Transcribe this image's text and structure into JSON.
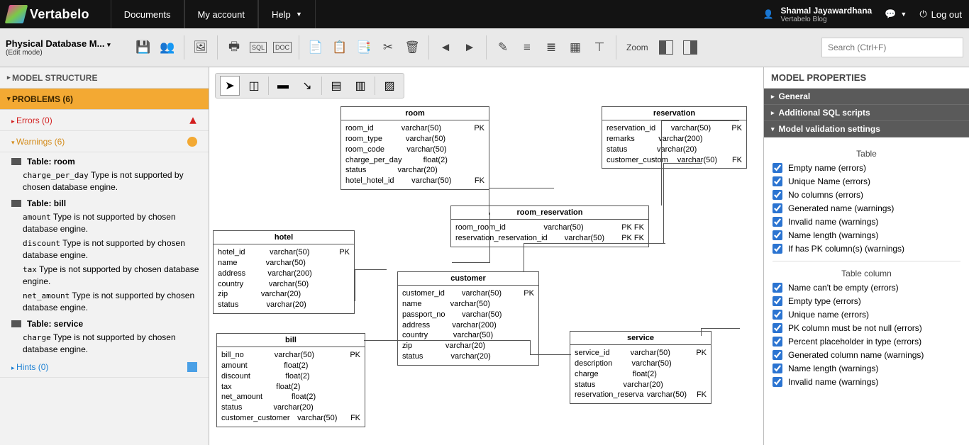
{
  "top": {
    "brand": "Vertabelo",
    "nav": {
      "documents": "Documents",
      "myaccount": "My account",
      "help": "Help"
    },
    "user": {
      "name": "Shamal Jayawardhana",
      "sub": "Vertabelo Blog"
    },
    "logout": "Log out"
  },
  "toolbar": {
    "title": "Physical Database M...",
    "subtitle": "(Edit mode)",
    "zoom_label": "Zoom",
    "search_placeholder": "Search (Ctrl+F)"
  },
  "left": {
    "model_structure": "MODEL STRUCTURE",
    "problems": "PROBLEMS (6)",
    "errors": "Errors (0)",
    "warnings": "Warnings (6)",
    "hints": "Hints (0)",
    "issues": [
      {
        "table": "Table: room",
        "lines": [
          {
            "code": "charge_per_day",
            "text": "Type is not supported by chosen database engine."
          }
        ]
      },
      {
        "table": "Table: bill",
        "lines": [
          {
            "code": "amount",
            "text": "Type is not supported by chosen database engine."
          },
          {
            "code": "discount",
            "text": "Type is not supported by chosen database engine."
          },
          {
            "code": "tax",
            "text": "Type is not supported by chosen database engine."
          },
          {
            "code": "net_amount",
            "text": "Type is not supported by chosen database engine."
          }
        ]
      },
      {
        "table": "Table: service",
        "lines": [
          {
            "code": "charge",
            "text": "Type is not supported by chosen database engine."
          }
        ]
      }
    ]
  },
  "entities": {
    "room": {
      "title": "room",
      "cols": [
        [
          "room_id",
          "varchar(50)",
          "PK"
        ],
        [
          "room_type",
          "varchar(50)",
          ""
        ],
        [
          "room_code",
          "varchar(50)",
          ""
        ],
        [
          "charge_per_day",
          "float(2)",
          ""
        ],
        [
          "status",
          "varchar(20)",
          ""
        ],
        [
          "hotel_hotel_id",
          "varchar(50)",
          "FK"
        ]
      ]
    },
    "reservation": {
      "title": "reservation",
      "cols": [
        [
          "reservation_id",
          "varchar(50)",
          "PK"
        ],
        [
          "remarks",
          "varchar(200)",
          ""
        ],
        [
          "status",
          "varchar(20)",
          ""
        ],
        [
          "customer_custom",
          "varchar(50)",
          "FK"
        ]
      ]
    },
    "room_reservation": {
      "title": "room_reservation",
      "cols": [
        [
          "room_room_id",
          "varchar(50)",
          "PK FK"
        ],
        [
          "reservation_reservation_id",
          "varchar(50)",
          "PK FK"
        ]
      ]
    },
    "hotel": {
      "title": "hotel",
      "cols": [
        [
          "hotel_id",
          "varchar(50)",
          "PK"
        ],
        [
          "name",
          "varchar(50)",
          ""
        ],
        [
          "address",
          "varchar(200)",
          ""
        ],
        [
          "country",
          "varchar(50)",
          ""
        ],
        [
          "zip",
          "varchar(20)",
          ""
        ],
        [
          "status",
          "varchar(20)",
          ""
        ]
      ]
    },
    "customer": {
      "title": "customer",
      "cols": [
        [
          "customer_id",
          "varchar(50)",
          "PK"
        ],
        [
          "name",
          "varchar(50)",
          ""
        ],
        [
          "passport_no",
          "varchar(50)",
          ""
        ],
        [
          "address",
          "varchar(200)",
          ""
        ],
        [
          "country",
          "varchar(50)",
          ""
        ],
        [
          "zip",
          "varchar(20)",
          ""
        ],
        [
          "status",
          "varchar(20)",
          ""
        ]
      ]
    },
    "bill": {
      "title": "bill",
      "cols": [
        [
          "bill_no",
          "varchar(50)",
          "PK"
        ],
        [
          "amount",
          "float(2)",
          ""
        ],
        [
          "discount",
          "float(2)",
          ""
        ],
        [
          "tax",
          "float(2)",
          ""
        ],
        [
          "net_amount",
          "float(2)",
          ""
        ],
        [
          "status",
          "varchar(20)",
          ""
        ],
        [
          "customer_customer",
          "varchar(50)",
          "FK"
        ]
      ]
    },
    "service": {
      "title": "service",
      "cols": [
        [
          "service_id",
          "varchar(50)",
          "PK"
        ],
        [
          "description",
          "varchar(50)",
          ""
        ],
        [
          "charge",
          "float(2)",
          ""
        ],
        [
          "status",
          "varchar(20)",
          ""
        ],
        [
          "reservation_reserva",
          "varchar(50)",
          "FK"
        ]
      ]
    }
  },
  "right": {
    "title": "MODEL PROPERTIES",
    "acc": {
      "general": "General",
      "scripts": "Additional SQL scripts",
      "validation": "Model validation settings"
    },
    "sub_table": "Table",
    "checks_table": [
      "Empty name (errors)",
      "Unique Name (errors)",
      "No columns (errors)",
      "Generated name (warnings)",
      "Invalid name (warnings)",
      "Name length (warnings)",
      "If has PK column(s) (warnings)"
    ],
    "sub_col": "Table column",
    "checks_col": [
      "Name can't be empty (errors)",
      "Empty type (errors)",
      "Unique name (errors)",
      "PK column must be not null (errors)",
      "Percent placeholder in type (errors)",
      "Generated column name (warnings)",
      "Name length (warnings)",
      "Invalid name (warnings)"
    ]
  }
}
